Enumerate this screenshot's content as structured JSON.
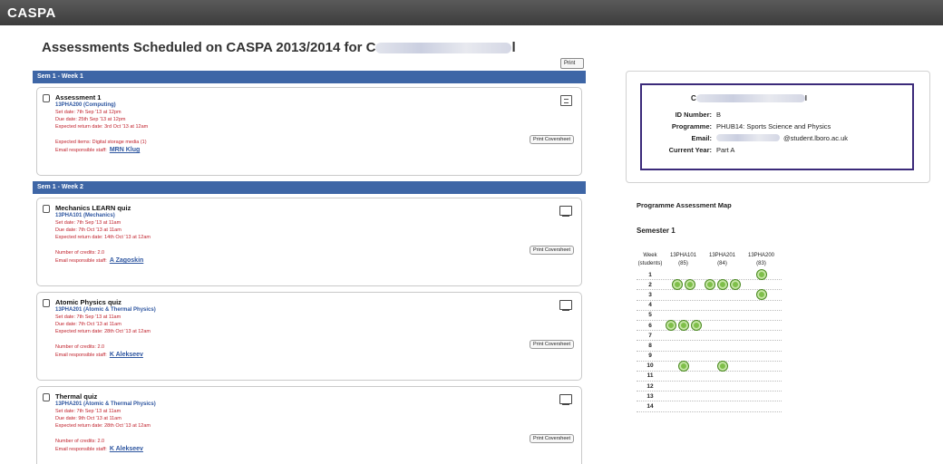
{
  "app": {
    "title": "CASPA"
  },
  "page": {
    "title": "Assessments Scheduled on CASPA 2013/2014 for C",
    "title_tail": "l",
    "print_label": "Print"
  },
  "weeks": [
    {
      "label": "Sem 1 - Week 1"
    },
    {
      "label": "Sem 1 - Week 2"
    }
  ],
  "cards": [
    {
      "title": "Assessment 1",
      "module": "13PHA200 (Computing)",
      "set": "Set date:  7th Sep '13 at 12pm",
      "due": "Due date:  25th Sep '13 at 12pm",
      "ret": "Expected return date:  3rd Oct '13 at 12am",
      "extra1": "Expected items:   Digital storage media (1)",
      "staff_label": "Email responsible staff:",
      "staff": "MRN Klug",
      "cover": "Print Coversheet"
    },
    {
      "title": "Mechanics LEARN quiz",
      "module": "13PHA101 (Mechanics)",
      "set": "Set date:  7th Sep '13 at 11am",
      "due": "Due date:  7th Oct '13 at 11am",
      "ret": "Expected return date:  14th Oct '13 at 12am",
      "extra1": "Number of credits:   2.0",
      "staff_label": "Email responsible staff:",
      "staff": "A Zagoskin",
      "cover": "Print Coversheet"
    },
    {
      "title": "Atomic Physics quiz",
      "module": "13PHA201 (Atomic & Thermal Physics)",
      "set": "Set date:  7th Sep '13 at 11am",
      "due": "Due date:  7th Oct '13 at 11am",
      "ret": "Expected return date:  28th Oct '13 at 12am",
      "extra1": "Number of credits:   2.0",
      "staff_label": "Email responsible staff:",
      "staff": "K Alekseev",
      "cover": "Print Coversheet"
    },
    {
      "title": "Thermal quiz",
      "module": "13PHA201 (Atomic & Thermal Physics)",
      "set": "Set date:  7th Sep '13 at 11am",
      "due": "Due date:  9th Oct '13 at 11am",
      "ret": "Expected return date:  28th Oct '13 at 12am",
      "extra1": "Number of credits:   2.0",
      "staff_label": "Email responsible staff:",
      "staff": "K Alekseev",
      "cover": "Print Coversheet"
    }
  ],
  "student": {
    "name": "C",
    "name_tail": "l",
    "id_label": "ID Number:",
    "id": "B",
    "prog_label": "Programme:",
    "prog": "PHUB14: Sports Science and Physics",
    "email_label": "Email:",
    "email": "@student.lboro.ac.uk",
    "year_label": "Current Year:",
    "year": "Part A"
  },
  "map": {
    "title": "Programme Assessment Map",
    "semester": "Semester 1",
    "week_header": "Week",
    "students_header": "(students)",
    "modules": [
      {
        "code": "13PHA101",
        "students": "(85)"
      },
      {
        "code": "13PHA201",
        "students": "(84)"
      },
      {
        "code": "13PHA200",
        "students": "(83)"
      }
    ],
    "rows": [
      {
        "week": "1",
        "counts": [
          0,
          0,
          1
        ]
      },
      {
        "week": "2",
        "counts": [
          2,
          3,
          0
        ]
      },
      {
        "week": "3",
        "counts": [
          0,
          0,
          1
        ]
      },
      {
        "week": "4",
        "counts": [
          0,
          0,
          0
        ]
      },
      {
        "week": "5",
        "counts": [
          0,
          0,
          0
        ]
      },
      {
        "week": "6",
        "counts": [
          3,
          0,
          0
        ]
      },
      {
        "week": "7",
        "counts": [
          0,
          0,
          0
        ]
      },
      {
        "week": "8",
        "counts": [
          0,
          0,
          0
        ]
      },
      {
        "week": "9",
        "counts": [
          0,
          0,
          0
        ]
      },
      {
        "week": "10",
        "counts": [
          1,
          1,
          0
        ]
      },
      {
        "week": "11",
        "counts": [
          0,
          0,
          0
        ]
      },
      {
        "week": "12",
        "counts": [
          0,
          0,
          0
        ]
      },
      {
        "week": "13",
        "counts": [
          0,
          0,
          0
        ]
      },
      {
        "week": "14",
        "counts": [
          0,
          0,
          0
        ]
      }
    ]
  }
}
